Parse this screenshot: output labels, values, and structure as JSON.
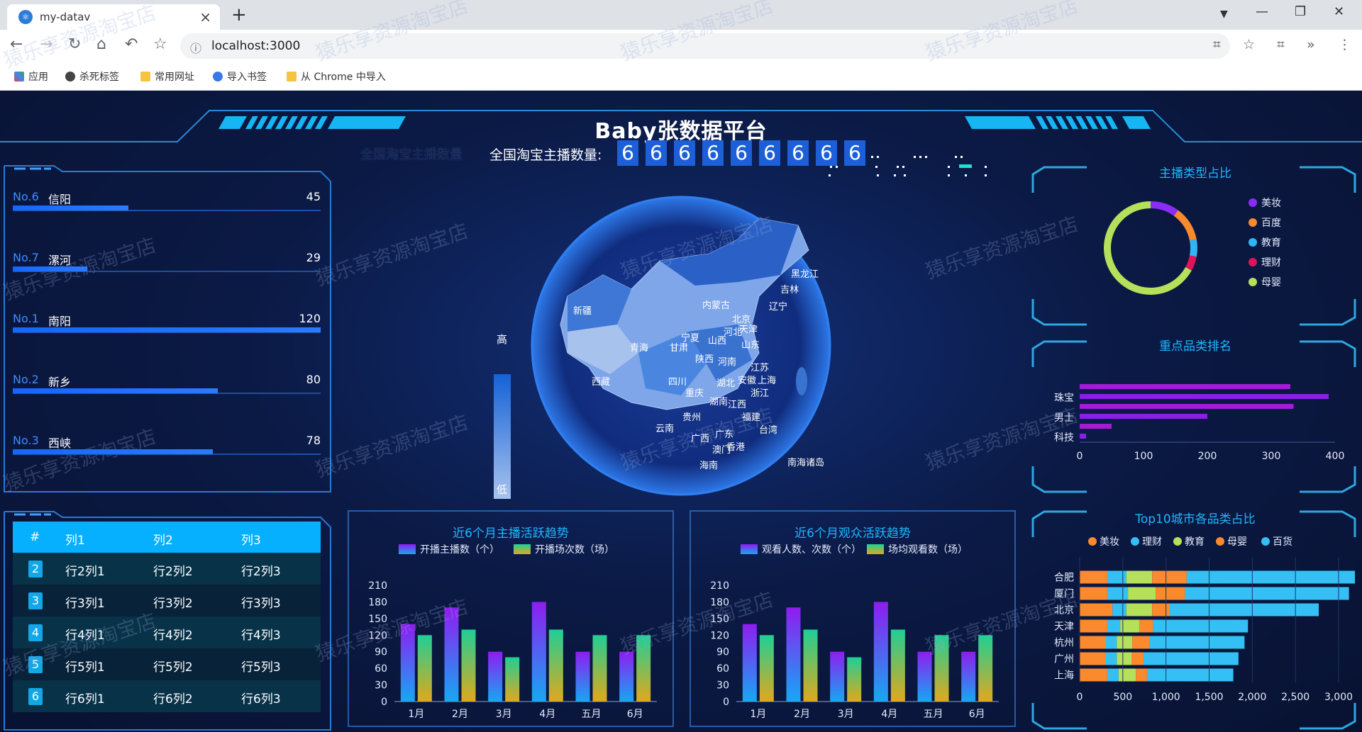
{
  "browser": {
    "tab_title": "my-datav",
    "url": "localhost:3000",
    "bookmarks": [
      "应用",
      "杀死标签",
      "常用网址",
      "导入书签",
      "从 Chrome 中导入"
    ]
  },
  "dashboard": {
    "title": "Baby张数据平台",
    "counter": {
      "shadow_label": "全国淘宝主播数量",
      "label": "全国淘宝主播数量:",
      "digits": [
        "6",
        "6",
        "6",
        "6",
        "6",
        "6",
        "6",
        "6",
        "6"
      ]
    },
    "ranking": [
      {
        "no": "No.6",
        "name": "信阳",
        "value": 45
      },
      {
        "no": "No.7",
        "name": "漯河",
        "value": 29
      },
      {
        "no": "No.1",
        "name": "南阳",
        "value": 120
      },
      {
        "no": "No.2",
        "name": "新乡",
        "value": 80
      },
      {
        "no": "No.3",
        "name": "西峡",
        "value": 78
      }
    ],
    "ranking_max": 120,
    "table": {
      "headers": [
        "#",
        "列1",
        "列2",
        "列3"
      ],
      "rows": [
        [
          "2",
          "行2列1",
          "行2列2",
          "行2列3"
        ],
        [
          "3",
          "行3列1",
          "行3列2",
          "行3列3"
        ],
        [
          "4",
          "行4列1",
          "行4列2",
          "行4列3"
        ],
        [
          "5",
          "行5列1",
          "行5列2",
          "行5列3"
        ],
        [
          "6",
          "行6列1",
          "行6列2",
          "行6列3"
        ]
      ]
    },
    "map": {
      "legend_high": "高",
      "legend_low": "低",
      "provinces": [
        "黑龙江",
        "吉林",
        "辽宁",
        "内蒙古",
        "北京",
        "天津",
        "河北",
        "新疆",
        "宁夏",
        "山西",
        "山东",
        "青海",
        "甘肃",
        "陕西",
        "河南",
        "江苏",
        "西藏",
        "四川",
        "湖北",
        "安徽",
        "上海",
        "重庆",
        "浙江",
        "湖南",
        "江西",
        "贵州",
        "福建",
        "云南",
        "广西",
        "广东",
        "台湾",
        "澳门",
        "香港",
        "海南",
        "南海诸岛"
      ]
    }
  },
  "chart_data": [
    {
      "type": "pie",
      "title": "主播类型占比",
      "categories": [
        "美妆",
        "百度",
        "教育",
        "理财",
        "母婴"
      ],
      "values": [
        10,
        12,
        6,
        5,
        67
      ],
      "colors": [
        "#8b2cf5",
        "#fb8a2e",
        "#2fb4f5",
        "#e0135a",
        "#b5e05a"
      ]
    },
    {
      "type": "bar",
      "title": "重点品类排名",
      "categories": [
        "科技",
        "",
        "男士",
        "",
        "珠宝",
        ""
      ],
      "values": [
        10,
        50,
        200,
        335,
        390,
        330
      ],
      "xlim": [
        0,
        400
      ],
      "xticks": [
        0,
        100,
        200,
        300,
        400
      ]
    },
    {
      "type": "bar",
      "title": "近6个月主播活跃趋势",
      "categories": [
        "1月",
        "2月",
        "3月",
        "4月",
        "五月",
        "6月"
      ],
      "series": [
        {
          "name": "开播主播数（个）",
          "values": [
            140,
            170,
            90,
            180,
            90,
            90
          ]
        },
        {
          "name": "开播场次数（场）",
          "values": [
            120,
            130,
            80,
            130,
            120,
            120
          ]
        }
      ],
      "ylim": [
        0,
        210
      ],
      "yticks": [
        0,
        30,
        60,
        90,
        120,
        150,
        180,
        210
      ]
    },
    {
      "type": "bar",
      "title": "近6个月观众活跃趋势",
      "categories": [
        "1月",
        "2月",
        "3月",
        "4月",
        "五月",
        "6月"
      ],
      "series": [
        {
          "name": "观看人数、次数（个）",
          "values": [
            140,
            170,
            90,
            180,
            90,
            90
          ]
        },
        {
          "name": "场均观看数（场）",
          "values": [
            120,
            130,
            80,
            130,
            120,
            120
          ]
        }
      ],
      "ylim": [
        0,
        210
      ],
      "yticks": [
        0,
        30,
        60,
        90,
        120,
        150,
        180,
        210
      ]
    },
    {
      "type": "bar",
      "title": "Top10城市各品类占比",
      "categories": [
        "上海",
        "广州",
        "杭州",
        "天津",
        "北京",
        "厦门",
        "合肥"
      ],
      "series": [
        {
          "name": "美妆",
          "values": [
            320,
            300,
            300,
            320,
            380,
            320,
            320
          ]
        },
        {
          "name": "理财",
          "values": [
            130,
            130,
            130,
            150,
            160,
            240,
            220
          ]
        },
        {
          "name": "教育",
          "values": [
            200,
            170,
            180,
            220,
            300,
            320,
            300
          ]
        },
        {
          "name": "母婴",
          "values": [
            130,
            140,
            200,
            160,
            200,
            340,
            400
          ]
        },
        {
          "name": "百货",
          "values": [
            1000,
            1100,
            1100,
            1100,
            1730,
            1900,
            1960
          ]
        }
      ],
      "xlim": [
        0,
        3000
      ],
      "xticks": [
        "0",
        "500",
        "1,000",
        "1,500",
        "2,000",
        "2,500",
        "3,000"
      ],
      "colors": [
        "#fb8a2e",
        "#35c0f5",
        "#b5e05a",
        "#fb8a2e",
        "#35c0f5"
      ]
    }
  ],
  "watermark": "猿乐享资源淘宝店"
}
